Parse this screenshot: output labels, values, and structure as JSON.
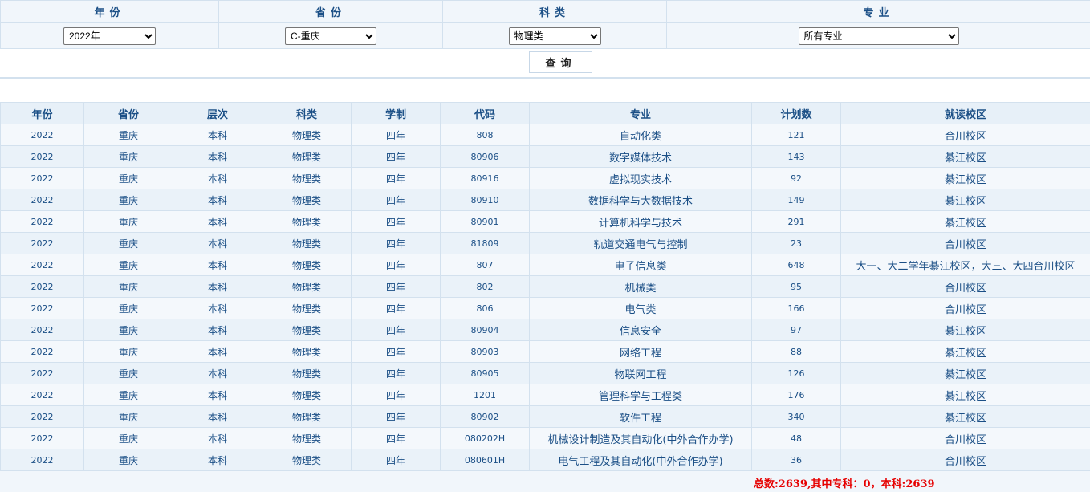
{
  "filters": {
    "year": {
      "label": "年份",
      "value": "2022年"
    },
    "province": {
      "label": "省份",
      "value": "C-重庆"
    },
    "subject": {
      "label": "科类",
      "value": "物理类"
    },
    "major": {
      "label": "专业",
      "value": "所有专业"
    }
  },
  "query_button": "查询",
  "table": {
    "headers": [
      "年份",
      "省份",
      "层次",
      "科类",
      "学制",
      "代码",
      "专业",
      "计划数",
      "就读校区"
    ],
    "rows": [
      [
        "2022",
        "重庆",
        "本科",
        "物理类",
        "四年",
        "808",
        "自动化类",
        "121",
        "合川校区"
      ],
      [
        "2022",
        "重庆",
        "本科",
        "物理类",
        "四年",
        "80906",
        "数字媒体技术",
        "143",
        "綦江校区"
      ],
      [
        "2022",
        "重庆",
        "本科",
        "物理类",
        "四年",
        "80916",
        "虚拟现实技术",
        "92",
        "綦江校区"
      ],
      [
        "2022",
        "重庆",
        "本科",
        "物理类",
        "四年",
        "80910",
        "数据科学与大数据技术",
        "149",
        "綦江校区"
      ],
      [
        "2022",
        "重庆",
        "本科",
        "物理类",
        "四年",
        "80901",
        "计算机科学与技术",
        "291",
        "綦江校区"
      ],
      [
        "2022",
        "重庆",
        "本科",
        "物理类",
        "四年",
        "81809",
        "轨道交通电气与控制",
        "23",
        "合川校区"
      ],
      [
        "2022",
        "重庆",
        "本科",
        "物理类",
        "四年",
        "807",
        "电子信息类",
        "648",
        "大一、大二学年綦江校区，大三、大四合川校区"
      ],
      [
        "2022",
        "重庆",
        "本科",
        "物理类",
        "四年",
        "802",
        "机械类",
        "95",
        "合川校区"
      ],
      [
        "2022",
        "重庆",
        "本科",
        "物理类",
        "四年",
        "806",
        "电气类",
        "166",
        "合川校区"
      ],
      [
        "2022",
        "重庆",
        "本科",
        "物理类",
        "四年",
        "80904",
        "信息安全",
        "97",
        "綦江校区"
      ],
      [
        "2022",
        "重庆",
        "本科",
        "物理类",
        "四年",
        "80903",
        "网络工程",
        "88",
        "綦江校区"
      ],
      [
        "2022",
        "重庆",
        "本科",
        "物理类",
        "四年",
        "80905",
        "物联网工程",
        "126",
        "綦江校区"
      ],
      [
        "2022",
        "重庆",
        "本科",
        "物理类",
        "四年",
        "1201",
        "管理科学与工程类",
        "176",
        "綦江校区"
      ],
      [
        "2022",
        "重庆",
        "本科",
        "物理类",
        "四年",
        "80902",
        "软件工程",
        "340",
        "綦江校区"
      ],
      [
        "2022",
        "重庆",
        "本科",
        "物理类",
        "四年",
        "080202H",
        "机械设计制造及其自动化(中外合作办学)",
        "48",
        "合川校区"
      ],
      [
        "2022",
        "重庆",
        "本科",
        "物理类",
        "四年",
        "080601H",
        "电气工程及其自动化(中外合作办学)",
        "36",
        "合川校区"
      ]
    ]
  },
  "total_text": "总数:2639,其中专科：0，本科:2639"
}
